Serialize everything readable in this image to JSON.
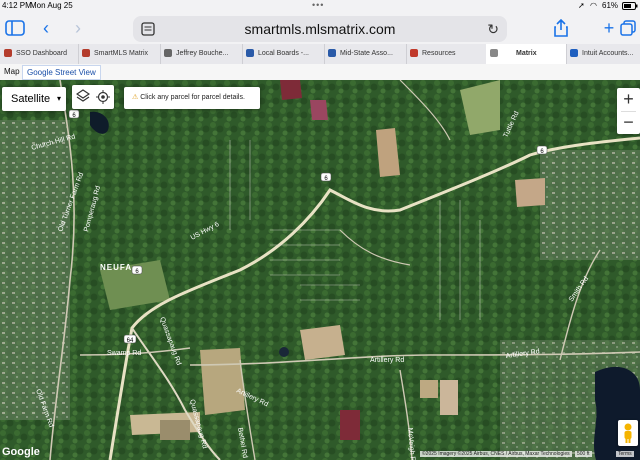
{
  "status": {
    "time": "4:12 PM",
    "date": "Mon Aug 25",
    "battery": "61%"
  },
  "browser": {
    "url": "smartmls.mlsmatrix.com",
    "tabs": [
      {
        "label": "SSO Dashboard",
        "fav_color": "#b43c2c"
      },
      {
        "label": "SmartMLS Matrix",
        "fav_color": "#b43c2c"
      },
      {
        "label": "Jeffrey Bouche...",
        "fav_color": "#666666"
      },
      {
        "label": "Local Boards -...",
        "fav_color": "#2a5aa8"
      },
      {
        "label": "Mid-State Asso...",
        "fav_color": "#2a5aa8"
      },
      {
        "label": "Resources",
        "fav_color": "#c0392b"
      },
      {
        "label": "Matrix",
        "fav_color": "#555555"
      },
      {
        "label": "Intuit Accounts...",
        "fav_color": "#1f5fbf"
      }
    ]
  },
  "map_tabs": {
    "map_label": "Map",
    "street_label": "Google Street View"
  },
  "map": {
    "type_label": "Satellite",
    "hint": "Click any parcel for parcel details.",
    "zoom_in": "+",
    "zoom_out": "−",
    "footer": {
      "brand": "Google",
      "attribution": "©2025 Imagery ©2025 Airbus, CNES / Airbus, Maxar Technologies",
      "scale": "500 ft",
      "terms": "Terms"
    },
    "labels": {
      "road1": "US Hwy 6",
      "road2": "Quassapaug Rd",
      "road3": "Swamp Rd",
      "road4": "Artillery Rd",
      "road5": "Artillery Rd",
      "road6": "Old Farm Rd",
      "road7": "Quassapaug Rd",
      "road8": "Bethel Rd",
      "road9": "Artillery Rd",
      "road10": "McVeigh Rd",
      "road11": "Tuttle Rd",
      "road12": "Old Turner Farm Rd",
      "road13": "Pomperaug Rd",
      "road14": "Church Hill Rd",
      "road15": "Smith Rd",
      "place": "NEUFA"
    },
    "shields": {
      "route6a": "6",
      "route6b": "6",
      "route6c": "6",
      "route64": "64",
      "route6d": "6"
    }
  }
}
